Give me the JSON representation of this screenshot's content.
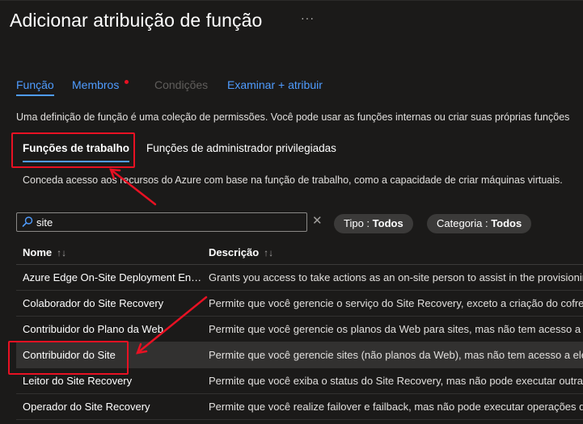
{
  "header": {
    "title": "Adicionar atribuição de função",
    "more_label": "···"
  },
  "tabs": [
    {
      "label": "Função",
      "state": "active"
    },
    {
      "label": "Membros",
      "state": "link",
      "has_dot": true
    },
    {
      "label": "Condições",
      "state": "disabled"
    },
    {
      "label": "Examinar + atribuir",
      "state": "link"
    }
  ],
  "description": "Uma definição de função é uma coleção de permissões. Você pode usar as funções internas ou criar suas próprias funções",
  "subtabs": [
    {
      "label": "Funções de trabalho",
      "active": true
    },
    {
      "label": "Funções de administrador privilegiadas",
      "active": false
    }
  ],
  "subtab_description": "Conceda acesso aos recursos do Azure com base na função de trabalho, como a capacidade de criar máquinas virtuais.",
  "search": {
    "value": "site",
    "placeholder": ""
  },
  "filters": [
    {
      "label": "Tipo : ",
      "value": "Todos"
    },
    {
      "label": "Categoria : ",
      "value": "Todos"
    }
  ],
  "table": {
    "columns": [
      {
        "label": "Nome",
        "sort": "↑↓"
      },
      {
        "label": "Descrição",
        "sort": "↑↓"
      }
    ],
    "rows": [
      {
        "name": "Azure Edge On-Site Deployment Eng...",
        "description": "Grants you access to take actions as an on-site person to assist in the provisioning"
      },
      {
        "name": "Colaborador do Site Recovery",
        "description": "Permite que você gerencie o serviço do Site Recovery, exceto a criação do cofre e"
      },
      {
        "name": "Contribuidor do Plano da Web",
        "description": "Permite que você gerencie os planos da Web para sites, mas não tem acesso a eles."
      },
      {
        "name": "Contribuidor do Site",
        "description": "Permite que você gerencie sites (não planos da Web), mas não tem acesso a eles."
      },
      {
        "name": "Leitor do Site Recovery",
        "description": "Permite que você exiba o status do Site Recovery, mas não pode executar outras"
      },
      {
        "name": "Operador do Site Recovery",
        "description": "Permite que você realize failover e failback, mas não pode executar operações de"
      }
    ],
    "selected_row": 3
  },
  "colors": {
    "background": "#1b1a19",
    "accent": "#4f9cff",
    "annotation_red": "#e81123"
  }
}
